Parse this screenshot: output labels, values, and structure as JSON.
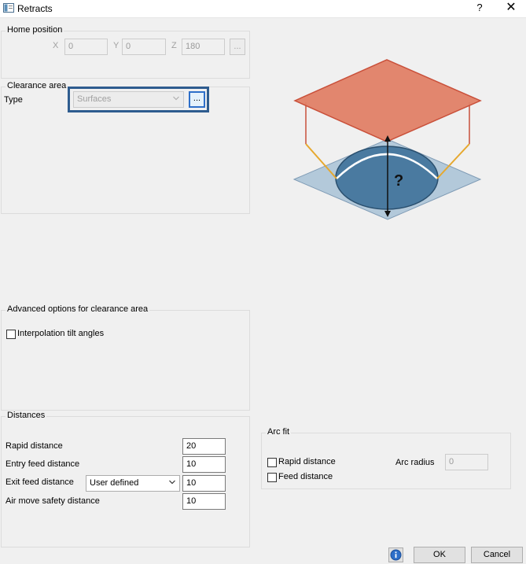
{
  "window": {
    "title": "Retracts",
    "help_glyph": "?",
    "close_glyph": "✕"
  },
  "home_position": {
    "title": "Home position",
    "x_label": "X",
    "x_value": "0",
    "y_label": "Y",
    "y_value": "0",
    "z_label": "Z",
    "z_value": "180",
    "browse_label": "..."
  },
  "clearance_area": {
    "title": "Clearance area",
    "type_label": "Type",
    "type_value": "Surfaces",
    "browse_label": "..."
  },
  "diagram": {
    "question_mark": "?",
    "colors": {
      "top_plane": "#e07f66",
      "top_plane_edge": "#c9503a",
      "bottom_plane": "#b3c9da",
      "ellipse": "#4a7aa0",
      "ellipse_edge": "#2a4f6e",
      "leg_upper": "#c9503a",
      "leg_lower": "#e6a82e",
      "arrow": "#111111"
    }
  },
  "advanced_options": {
    "title": "Advanced options for clearance area",
    "interpolation_label": "Interpolation tilt angles",
    "interpolation_checked": false
  },
  "distances": {
    "title": "Distances",
    "rapid_label": "Rapid distance",
    "rapid_value": "20",
    "entry_label": "Entry feed distance",
    "entry_value": "10",
    "exit_label": "Exit feed distance",
    "exit_mode": "User defined",
    "exit_value": "10",
    "air_label": "Air move safety distance",
    "air_value": "10"
  },
  "arc_fit": {
    "title": "Arc fit",
    "rapid_label": "Rapid distance",
    "rapid_checked": false,
    "feed_label": "Feed distance",
    "feed_checked": false,
    "radius_label": "Arc radius",
    "radius_value": "0"
  },
  "footer": {
    "ok_label": "OK",
    "cancel_label": "Cancel"
  }
}
